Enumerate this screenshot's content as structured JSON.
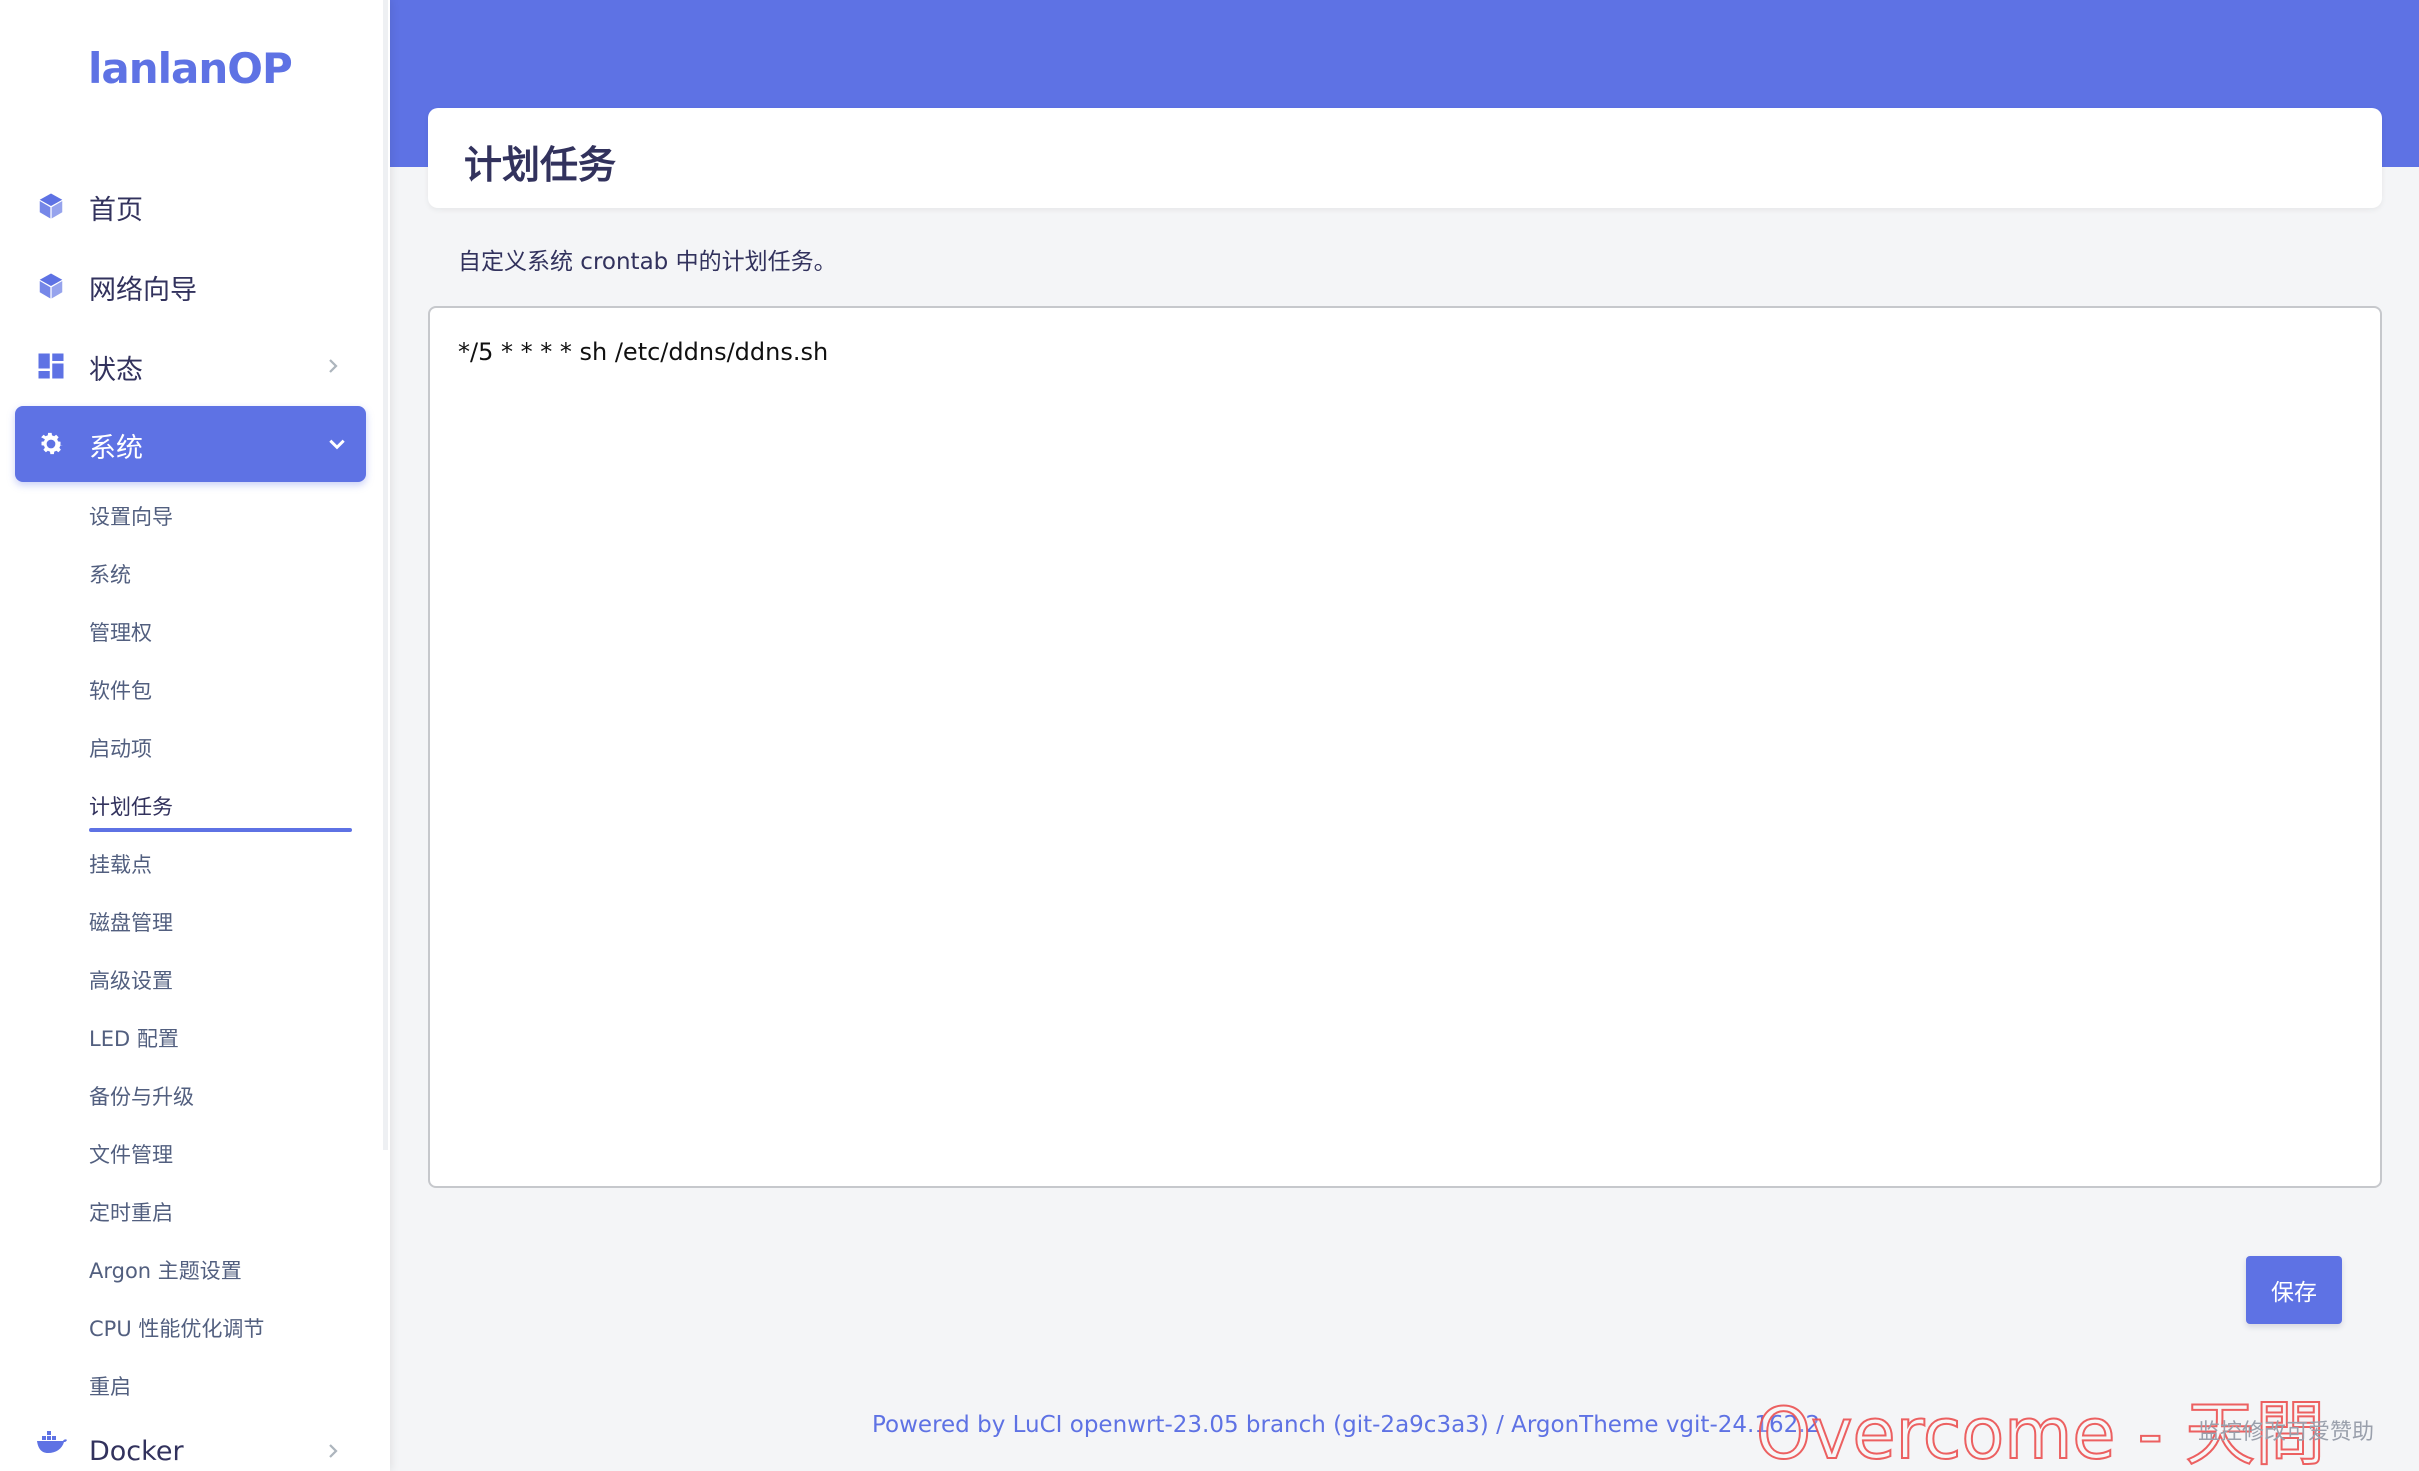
{
  "brand": {
    "logo": "lanlanOP",
    "accent": "#5e72e4"
  },
  "nav": {
    "home": "首页",
    "wizard": "网络向导",
    "status": "状态",
    "system": "系统",
    "docker": "Docker"
  },
  "system_submenu": [
    "设置向导",
    "系统",
    "管理权",
    "软件包",
    "启动项",
    "计划任务",
    "挂载点",
    "磁盘管理",
    "高级设置",
    "LED 配置",
    "备份与升级",
    "文件管理",
    "定时重启",
    "Argon 主题设置",
    "CPU 性能优化调节",
    "重启"
  ],
  "page": {
    "title": "计划任务",
    "description": "自定义系统 crontab 中的计划任务。",
    "crontab": "*/5 * * * * sh /etc/ddns/ddns.sh",
    "save_label": "保存"
  },
  "footer": {
    "text": "Powered by LuCI openwrt-23.05 branch (git-2a9c3a3) / ArgonTheme vgit-24.162.2"
  },
  "watermark": {
    "main": "Overcome - 天問",
    "sub": "监控修改可爱赞助"
  }
}
